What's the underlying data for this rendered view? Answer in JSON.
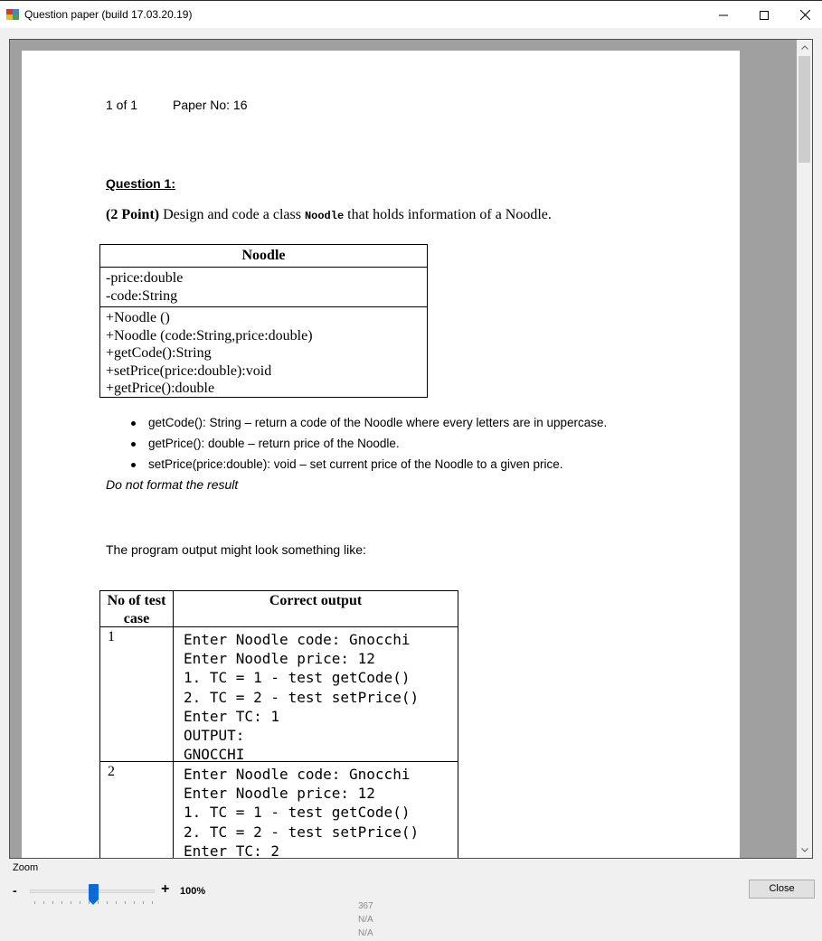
{
  "window": {
    "title": "Question paper (build 17.03.20.19)",
    "minimize_glyph": "—",
    "maximize_glyph": "☐",
    "close_glyph": "✕"
  },
  "paper": {
    "page": "1 of 1",
    "paper_no": "Paper No: 16",
    "question_title": "Question 1:",
    "question_points": "(2 Point)",
    "question_text_a": " Design and code a class ",
    "question_class": "Noodle",
    "question_text_b": " that holds information of a Noodle.",
    "uml": {
      "class_name": "Noodle",
      "attributes": [
        "-price:double",
        "-code:String"
      ],
      "methods": [
        "+Noodle ()",
        "+Noodle (code:String,price:double)",
        "+getCode():String",
        "+setPrice(price:double):void",
        "+getPrice():double"
      ]
    },
    "bullets": [
      "getCode(): String – return a code of the Noodle where every letters are in uppercase.",
      "getPrice(): double – return price of the Noodle.",
      "setPrice(price:double): void – set current price of the Noodle to a given price."
    ],
    "note": "Do not format the result",
    "output_intro": "The program output might look something like:",
    "table": {
      "col1_header": "No of test case",
      "col2_header": "Correct output",
      "rows": [
        {
          "num": "1",
          "output": "Enter Noodle code: Gnocchi\nEnter Noodle price: 12\n1. TC = 1 - test getCode()\n2. TC = 2 - test setPrice()\nEnter TC: 1\nOUTPUT:\nGNOCCHI"
        },
        {
          "num": "2",
          "output": "Enter Noodle code: Gnocchi\nEnter Noodle price: 12\n1. TC = 1 - test getCode()\n2. TC = 2 - test setPrice()\nEnter TC: 2"
        }
      ]
    }
  },
  "controls": {
    "zoom_label": "Zoom",
    "zoom_minus": "-",
    "zoom_plus": "+",
    "zoom_value": "100%",
    "zoom_level_percent": 100,
    "info_lines": [
      "367",
      "N/A",
      "N/A"
    ],
    "close_label": "Close"
  },
  "colors": {
    "accent": "#0a6ad6",
    "viewer_bg": "#a0a0a0"
  }
}
